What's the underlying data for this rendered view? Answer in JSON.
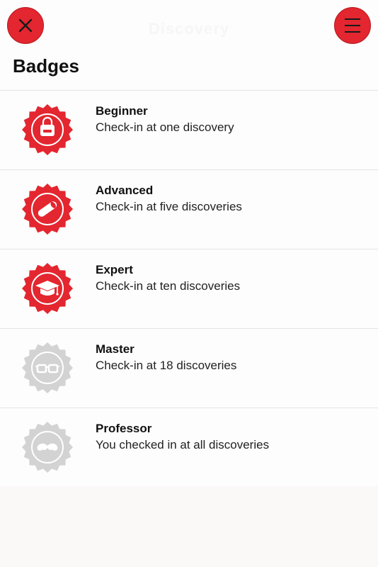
{
  "header": {
    "title": "Discovery",
    "close_icon": "close-icon",
    "menu_icon": "hamburger-menu-icon",
    "accent": "#e3262f"
  },
  "page_title": "Badges",
  "badges": [
    {
      "title": "Beginner",
      "description": "Check-in at one discovery",
      "icon": "backpack-icon",
      "earned": true
    },
    {
      "title": "Advanced",
      "description": "Check-in at five discoveries",
      "icon": "diploma-icon",
      "earned": true
    },
    {
      "title": "Expert",
      "description": "Check-in at ten discoveries",
      "icon": "graduation-cap-icon",
      "earned": true
    },
    {
      "title": "Master",
      "description": "Check-in at 18 discoveries",
      "icon": "glasses-icon",
      "earned": false
    },
    {
      "title": "Professor",
      "description": "You checked in at all discoveries",
      "icon": "mustache-icon",
      "earned": false
    }
  ],
  "colors": {
    "earned": "#e3262f",
    "locked": "#d3d3d3",
    "divider": "#e4e4e4"
  }
}
